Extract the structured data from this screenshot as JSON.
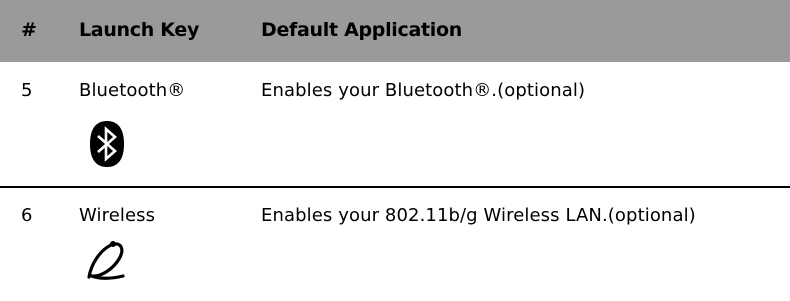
{
  "table": {
    "headers": [
      "#",
      "Launch Key",
      "Default Application"
    ],
    "rows": [
      {
        "number": "5",
        "key": "Bluetooth®",
        "application": "Enables your Bluetooth®.(optional)",
        "icon": "bluetooth-icon"
      },
      {
        "number": "6",
        "key": "Wireless",
        "application": "Enables your 802.11b/g Wireless LAN.(optional)",
        "icon": "wireless-icon"
      }
    ]
  },
  "colors": {
    "header_background": "#9a9a9a",
    "text": "#000000",
    "divider": "#000000"
  }
}
